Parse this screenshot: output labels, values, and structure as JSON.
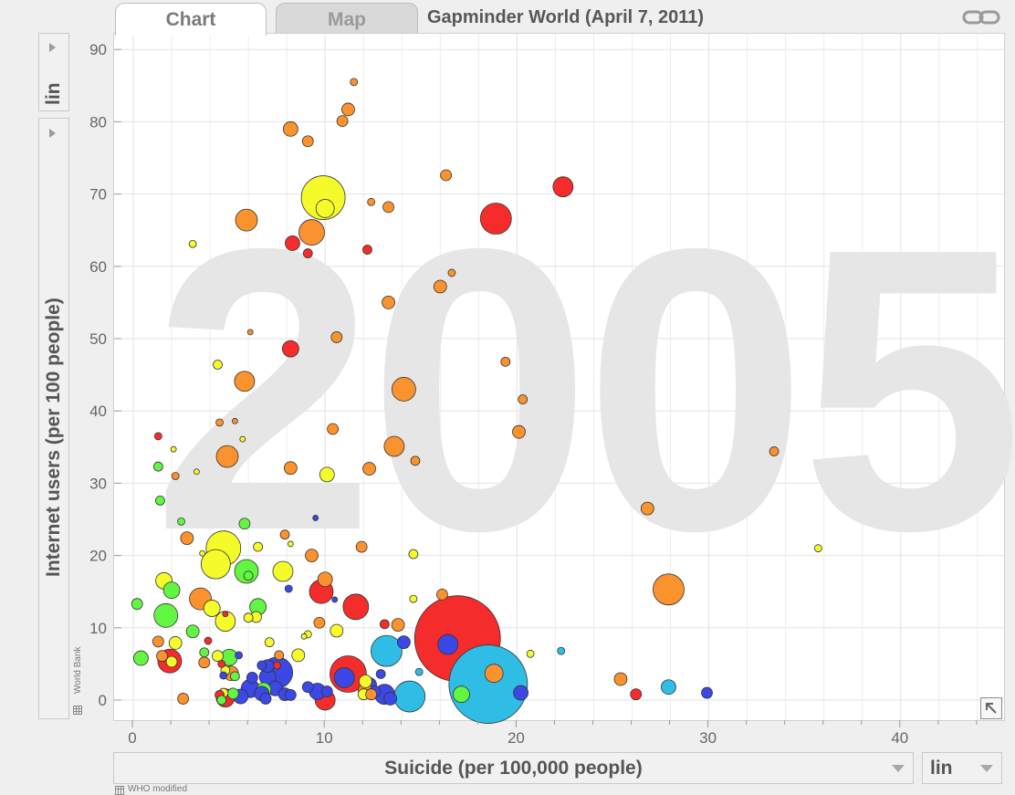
{
  "tabs": {
    "chart": "Chart",
    "map": "Map"
  },
  "title": "Gapminder World (April 7, 2011)",
  "year_watermark": "2005",
  "y_scale": "lin",
  "x_scale": "lin",
  "sources": {
    "x": "WHO modified",
    "y": "World Bank"
  },
  "colors": {
    "red": "#f52c2c",
    "orange": "#fa922e",
    "yellow": "#f5fa2a",
    "green": "#62f542",
    "blue": "#3b48e6",
    "cyan": "#2fbde6"
  },
  "chart_data": {
    "type": "scatter",
    "title": "",
    "xlabel": "Suicide (per 100,000 people)",
    "ylabel": "Internet users (per 100 people)",
    "xlim": [
      -0.5,
      45
    ],
    "ylim": [
      -2.5,
      92.5
    ],
    "x_ticks": [
      0,
      10,
      20,
      30,
      40
    ],
    "y_ticks": [
      0,
      10,
      20,
      30,
      40,
      50,
      60,
      70,
      80,
      90
    ],
    "grid": true,
    "points": [
      {
        "x": 11.5,
        "y": 85.5,
        "r": 4,
        "c": "orange"
      },
      {
        "x": 11.2,
        "y": 81.7,
        "r": 7,
        "c": "orange"
      },
      {
        "x": 10.9,
        "y": 80.1,
        "r": 6,
        "c": "orange"
      },
      {
        "x": 8.2,
        "y": 79,
        "r": 8,
        "c": "orange"
      },
      {
        "x": 9.1,
        "y": 77.3,
        "r": 6,
        "c": "orange"
      },
      {
        "x": 16.3,
        "y": 72.6,
        "r": 6,
        "c": "orange"
      },
      {
        "x": 22.4,
        "y": 71,
        "r": 11,
        "c": "red"
      },
      {
        "x": 9.9,
        "y": 69.5,
        "r": 24,
        "c": "yellow"
      },
      {
        "x": 10,
        "y": 68,
        "r": 10,
        "c": "yellow"
      },
      {
        "x": 12.4,
        "y": 68.9,
        "r": 4,
        "c": "orange"
      },
      {
        "x": 13.3,
        "y": 68.2,
        "r": 6,
        "c": "orange"
      },
      {
        "x": 18.9,
        "y": 66.6,
        "r": 17,
        "c": "red"
      },
      {
        "x": 5.9,
        "y": 66.4,
        "r": 12,
        "c": "orange"
      },
      {
        "x": 9.3,
        "y": 64.7,
        "r": 14,
        "c": "orange"
      },
      {
        "x": 8.3,
        "y": 63.2,
        "r": 8,
        "c": "red"
      },
      {
        "x": 3.1,
        "y": 63.1,
        "r": 4,
        "c": "yellow"
      },
      {
        "x": 9.1,
        "y": 61.8,
        "r": 5,
        "c": "red"
      },
      {
        "x": 12.2,
        "y": 62.3,
        "r": 5,
        "c": "red"
      },
      {
        "x": 16.6,
        "y": 59.1,
        "r": 4,
        "c": "orange"
      },
      {
        "x": 16.0,
        "y": 57.2,
        "r": 7,
        "c": "orange"
      },
      {
        "x": 13.3,
        "y": 55,
        "r": 7,
        "c": "orange"
      },
      {
        "x": 6.1,
        "y": 50.9,
        "r": 3,
        "c": "orange"
      },
      {
        "x": 10.6,
        "y": 50.2,
        "r": 6,
        "c": "orange"
      },
      {
        "x": 8.2,
        "y": 48.6,
        "r": 9,
        "c": "red"
      },
      {
        "x": 4.4,
        "y": 46.4,
        "r": 5,
        "c": "yellow"
      },
      {
        "x": 19.4,
        "y": 46.8,
        "r": 5,
        "c": "orange"
      },
      {
        "x": 5.8,
        "y": 44.1,
        "r": 11,
        "c": "orange"
      },
      {
        "x": 14.1,
        "y": 43,
        "r": 13,
        "c": "orange"
      },
      {
        "x": 20.3,
        "y": 41.6,
        "r": 5,
        "c": "orange"
      },
      {
        "x": 4.5,
        "y": 38.4,
        "r": 4,
        "c": "orange"
      },
      {
        "x": 5.3,
        "y": 38.6,
        "r": 3,
        "c": "orange"
      },
      {
        "x": 10.4,
        "y": 37.5,
        "r": 6,
        "c": "orange"
      },
      {
        "x": 20.1,
        "y": 37.1,
        "r": 7,
        "c": "orange"
      },
      {
        "x": 1.3,
        "y": 36.5,
        "r": 4,
        "c": "red"
      },
      {
        "x": 5.7,
        "y": 36.1,
        "r": 3,
        "c": "yellow"
      },
      {
        "x": 2.1,
        "y": 34.7,
        "r": 3,
        "c": "yellow"
      },
      {
        "x": 13.6,
        "y": 35.1,
        "r": 11,
        "c": "orange"
      },
      {
        "x": 33.4,
        "y": 34.4,
        "r": 5,
        "c": "orange"
      },
      {
        "x": 4.9,
        "y": 33.7,
        "r": 12,
        "c": "orange"
      },
      {
        "x": 14.7,
        "y": 33.1,
        "r": 5,
        "c": "orange"
      },
      {
        "x": 1.3,
        "y": 32.3,
        "r": 5,
        "c": "green"
      },
      {
        "x": 8.2,
        "y": 32.1,
        "r": 7,
        "c": "orange"
      },
      {
        "x": 12.3,
        "y": 32,
        "r": 7,
        "c": "orange"
      },
      {
        "x": 3.3,
        "y": 31.6,
        "r": 3,
        "c": "yellow"
      },
      {
        "x": 2.2,
        "y": 31,
        "r": 4,
        "c": "orange"
      },
      {
        "x": 10.1,
        "y": 31.2,
        "r": 8,
        "c": "yellow"
      },
      {
        "x": 1.4,
        "y": 27.6,
        "r": 5,
        "c": "green"
      },
      {
        "x": 26.8,
        "y": 26.5,
        "r": 7,
        "c": "orange"
      },
      {
        "x": 9.5,
        "y": 25.2,
        "r": 3,
        "c": "blue"
      },
      {
        "x": 2.5,
        "y": 24.7,
        "r": 4,
        "c": "green"
      },
      {
        "x": 5.8,
        "y": 24.4,
        "r": 6,
        "c": "green"
      },
      {
        "x": 2.8,
        "y": 22.4,
        "r": 7,
        "c": "orange"
      },
      {
        "x": 7.9,
        "y": 22.9,
        "r": 5,
        "c": "orange"
      },
      {
        "x": 8.2,
        "y": 21.6,
        "r": 3,
        "c": "yellow"
      },
      {
        "x": 4.7,
        "y": 21,
        "r": 19,
        "c": "yellow"
      },
      {
        "x": 3.6,
        "y": 20.3,
        "r": 3,
        "c": "yellow"
      },
      {
        "x": 6.5,
        "y": 21.2,
        "r": 5,
        "c": "yellow"
      },
      {
        "x": 11.9,
        "y": 21.2,
        "r": 6,
        "c": "orange"
      },
      {
        "x": 9.3,
        "y": 20,
        "r": 7,
        "c": "orange"
      },
      {
        "x": 14.6,
        "y": 20.2,
        "r": 5,
        "c": "yellow"
      },
      {
        "x": 35.7,
        "y": 21,
        "r": 4,
        "c": "yellow"
      },
      {
        "x": 4.3,
        "y": 18.8,
        "r": 16,
        "c": "yellow"
      },
      {
        "x": 5.9,
        "y": 17.8,
        "r": 13,
        "c": "green"
      },
      {
        "x": 6,
        "y": 17.2,
        "r": 5,
        "c": "green"
      },
      {
        "x": 7.8,
        "y": 17.8,
        "r": 11,
        "c": "yellow"
      },
      {
        "x": 1.6,
        "y": 16.5,
        "r": 9,
        "c": "yellow"
      },
      {
        "x": 10,
        "y": 16.7,
        "r": 8,
        "c": "orange"
      },
      {
        "x": 2,
        "y": 15.2,
        "r": 9,
        "c": "green"
      },
      {
        "x": 8.1,
        "y": 15.4,
        "r": 4,
        "c": "blue"
      },
      {
        "x": 9.8,
        "y": 15,
        "r": 13,
        "c": "red"
      },
      {
        "x": 16.1,
        "y": 14.6,
        "r": 6,
        "c": "orange"
      },
      {
        "x": 27.9,
        "y": 15.3,
        "r": 17,
        "c": "orange"
      },
      {
        "x": 3.5,
        "y": 14,
        "r": 12,
        "c": "orange"
      },
      {
        "x": 10.5,
        "y": 13.9,
        "r": 3,
        "c": "blue"
      },
      {
        "x": 14.6,
        "y": 14,
        "r": 4,
        "c": "yellow"
      },
      {
        "x": 0.2,
        "y": 13.3,
        "r": 6,
        "c": "green"
      },
      {
        "x": 6.5,
        "y": 12.9,
        "r": 9,
        "c": "green"
      },
      {
        "x": 4.1,
        "y": 12.7,
        "r": 9,
        "c": "yellow"
      },
      {
        "x": 11.6,
        "y": 12.9,
        "r": 14,
        "c": "red"
      },
      {
        "x": 1.7,
        "y": 11.7,
        "r": 13,
        "c": "green"
      },
      {
        "x": 4.8,
        "y": 11.9,
        "r": 3,
        "c": "red"
      },
      {
        "x": 6.4,
        "y": 11.5,
        "r": 6,
        "c": "yellow"
      },
      {
        "x": 6,
        "y": 11.4,
        "r": 5,
        "c": "yellow"
      },
      {
        "x": 4.8,
        "y": 10.9,
        "r": 11,
        "c": "yellow"
      },
      {
        "x": 9.7,
        "y": 10.7,
        "r": 6,
        "c": "orange"
      },
      {
        "x": 13.8,
        "y": 10.4,
        "r": 7,
        "c": "orange"
      },
      {
        "x": 13.1,
        "y": 10.5,
        "r": 5,
        "c": "red"
      },
      {
        "x": 3.1,
        "y": 9.5,
        "r": 7,
        "c": "green"
      },
      {
        "x": 10.6,
        "y": 9.6,
        "r": 7,
        "c": "yellow"
      },
      {
        "x": 9.1,
        "y": 9.1,
        "r": 4,
        "c": "yellow"
      },
      {
        "x": 8.9,
        "y": 8.8,
        "r": 3,
        "c": "yellow"
      },
      {
        "x": 16.9,
        "y": 8.5,
        "r": 47,
        "c": "red"
      },
      {
        "x": 1.3,
        "y": 8.1,
        "r": 6,
        "c": "orange"
      },
      {
        "x": 3.9,
        "y": 8.2,
        "r": 4,
        "c": "red"
      },
      {
        "x": 7.1,
        "y": 8,
        "r": 5,
        "c": "yellow"
      },
      {
        "x": 14.1,
        "y": 8,
        "r": 7,
        "c": "blue"
      },
      {
        "x": 16.4,
        "y": 7.7,
        "r": 11,
        "c": "blue"
      },
      {
        "x": 2.2,
        "y": 7.9,
        "r": 7,
        "c": "yellow"
      },
      {
        "x": 13.2,
        "y": 6.8,
        "r": 17,
        "c": "cyan"
      },
      {
        "x": 22.3,
        "y": 6.8,
        "r": 4,
        "c": "cyan"
      },
      {
        "x": 20.7,
        "y": 6.4,
        "r": 4,
        "c": "yellow"
      },
      {
        "x": 0.4,
        "y": 5.8,
        "r": 8,
        "c": "green"
      },
      {
        "x": 3.7,
        "y": 6.6,
        "r": 5,
        "c": "green"
      },
      {
        "x": 4.4,
        "y": 6.1,
        "r": 6,
        "c": "yellow"
      },
      {
        "x": 1.5,
        "y": 6.1,
        "r": 6,
        "c": "orange"
      },
      {
        "x": 5,
        "y": 5.9,
        "r": 9,
        "c": "green"
      },
      {
        "x": 5.5,
        "y": 6.2,
        "r": 4,
        "c": "blue"
      },
      {
        "x": 8.6,
        "y": 6.2,
        "r": 7,
        "c": "yellow"
      },
      {
        "x": 7.6,
        "y": 6.2,
        "r": 5,
        "c": "orange"
      },
      {
        "x": 1.9,
        "y": 5.4,
        "r": 13,
        "c": "red"
      },
      {
        "x": 2,
        "y": 5.3,
        "r": 6,
        "c": "yellow"
      },
      {
        "x": 3.7,
        "y": 5.2,
        "r": 6,
        "c": "orange"
      },
      {
        "x": 4.6,
        "y": 5,
        "r": 4,
        "c": "red"
      },
      {
        "x": 6.7,
        "y": 4.8,
        "r": 5,
        "c": "blue"
      },
      {
        "x": 7,
        "y": 4.7,
        "r": 7,
        "c": "blue"
      },
      {
        "x": 7.5,
        "y": 4.8,
        "r": 4,
        "c": "red"
      },
      {
        "x": 4.8,
        "y": 4.1,
        "r": 5,
        "c": "yellow"
      },
      {
        "x": 5.1,
        "y": 3.7,
        "r": 8,
        "c": "orange"
      },
      {
        "x": 7.5,
        "y": 3.8,
        "r": 17,
        "c": "blue"
      },
      {
        "x": 4.7,
        "y": 3.4,
        "r": 4,
        "c": "blue"
      },
      {
        "x": 5.3,
        "y": 3.3,
        "r": 5,
        "c": "green"
      },
      {
        "x": 7,
        "y": 3.2,
        "r": 9,
        "c": "blue"
      },
      {
        "x": 6.2,
        "y": 3.1,
        "r": 6,
        "c": "blue"
      },
      {
        "x": 11.2,
        "y": 3.6,
        "r": 20,
        "c": "red"
      },
      {
        "x": 11,
        "y": 3.1,
        "r": 11,
        "c": "blue"
      },
      {
        "x": 12.9,
        "y": 3.6,
        "r": 5,
        "c": "blue"
      },
      {
        "x": 14.9,
        "y": 3.9,
        "r": 4,
        "c": "cyan"
      },
      {
        "x": 18.5,
        "y": 2.2,
        "r": 43,
        "c": "cyan"
      },
      {
        "x": 18.8,
        "y": 3.7,
        "r": 10,
        "c": "orange"
      },
      {
        "x": 25.4,
        "y": 2.9,
        "r": 7,
        "c": "orange"
      },
      {
        "x": 12.1,
        "y": 2.6,
        "r": 7,
        "c": "yellow"
      },
      {
        "x": 12.3,
        "y": 2.1,
        "r": 8,
        "c": "blue"
      },
      {
        "x": 9.1,
        "y": 1.8,
        "r": 6,
        "c": "blue"
      },
      {
        "x": 6.1,
        "y": 1.6,
        "r": 10,
        "c": "blue"
      },
      {
        "x": 7.4,
        "y": 1.6,
        "r": 8,
        "c": "blue"
      },
      {
        "x": 6.8,
        "y": 1.4,
        "r": 8,
        "c": "green"
      },
      {
        "x": 9.6,
        "y": 1.2,
        "r": 9,
        "c": "blue"
      },
      {
        "x": 10.1,
        "y": 1.2,
        "r": 6,
        "c": "blue"
      },
      {
        "x": 12.1,
        "y": 1.3,
        "r": 8,
        "c": "orange"
      },
      {
        "x": 12.6,
        "y": 1.2,
        "r": 6,
        "c": "blue"
      },
      {
        "x": 27.9,
        "y": 1.8,
        "r": 8,
        "c": "cyan"
      },
      {
        "x": 4.7,
        "y": 1,
        "r": 5,
        "c": "yellow"
      },
      {
        "x": 5.2,
        "y": 0.9,
        "r": 6,
        "c": "green"
      },
      {
        "x": 12,
        "y": 0.8,
        "r": 6,
        "c": "yellow"
      },
      {
        "x": 12.4,
        "y": 0.8,
        "r": 6,
        "c": "orange"
      },
      {
        "x": 13.1,
        "y": 0.8,
        "r": 11,
        "c": "blue"
      },
      {
        "x": 14.4,
        "y": 0.5,
        "r": 17,
        "c": "cyan"
      },
      {
        "x": 17.1,
        "y": 0.8,
        "r": 9,
        "c": "green"
      },
      {
        "x": 20.2,
        "y": 1,
        "r": 8,
        "c": "blue"
      },
      {
        "x": 26.2,
        "y": 0.8,
        "r": 6,
        "c": "red"
      },
      {
        "x": 29.9,
        "y": 1,
        "r": 6,
        "c": "blue"
      },
      {
        "x": 6.7,
        "y": 0.9,
        "r": 8,
        "c": "blue"
      },
      {
        "x": 7.9,
        "y": 0.8,
        "r": 7,
        "c": "blue"
      },
      {
        "x": 8.2,
        "y": 0.7,
        "r": 6,
        "c": "blue"
      },
      {
        "x": 4.5,
        "y": 0.7,
        "r": 5,
        "c": "red"
      },
      {
        "x": 5.6,
        "y": 0.5,
        "r": 8,
        "c": "blue"
      },
      {
        "x": 4.8,
        "y": 0.3,
        "r": 10,
        "c": "red"
      },
      {
        "x": 2.6,
        "y": 0.2,
        "r": 6,
        "c": "orange"
      },
      {
        "x": 10,
        "y": 0,
        "r": 11,
        "c": "red"
      },
      {
        "x": 13.4,
        "y": 0.2,
        "r": 7,
        "c": "blue"
      },
      {
        "x": 6.9,
        "y": 0.2,
        "r": 6,
        "c": "blue"
      },
      {
        "x": 4.6,
        "y": 0,
        "r": 5,
        "c": "green"
      }
    ]
  }
}
